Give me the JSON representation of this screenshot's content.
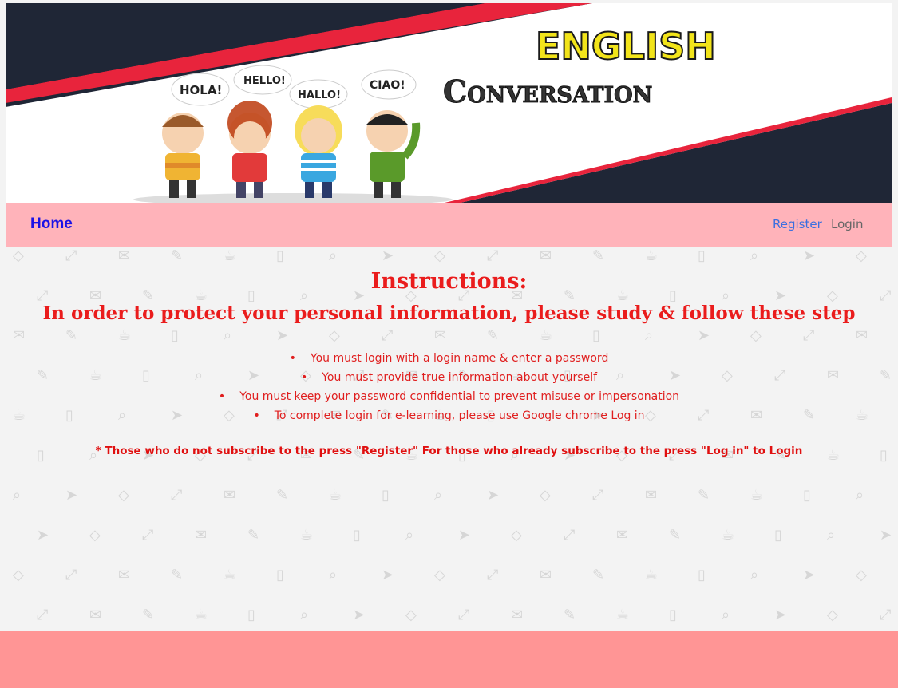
{
  "banner": {
    "title_line1": "ENGLISH",
    "title_line2": "Conversation",
    "bubbles": [
      "HOLA!",
      "HELLO!",
      "HALLO!",
      "CIAO!"
    ],
    "prev_icon": "chevron-left-icon",
    "next_icon": "chevron-right-icon",
    "prev_glyph": "‹",
    "next_glyph": "›",
    "slide_count": 3,
    "active_slide": 1
  },
  "nav": {
    "home_label": "Home",
    "register_label": "Register",
    "login_label": "Login"
  },
  "instructions": {
    "title": "Instructions:",
    "subtitle": "In order to protect your personal information, please study & follow these step",
    "steps": [
      "You must login with a login name & enter a password",
      "You must provide true information about yourself",
      "You must keep your password confidential to prevent misuse or impersonation",
      "To complete login for e-learning, please use Google chrome Log in"
    ],
    "bullet": "•",
    "note": "* Those who do not subscribe to the press \"Register\" For those who already subscribe to the press \"Log in\" to Login"
  },
  "colors": {
    "nav_bg": "#ffb3ba",
    "footer_bg": "#ff9595",
    "title_red": "#ea1c1c",
    "home_blue": "#1a12e6",
    "register_blue": "#3b6fe0",
    "banner_dark": "#1f2636",
    "banner_red": "#e8243c",
    "title_yellow": "#f2e41a"
  }
}
